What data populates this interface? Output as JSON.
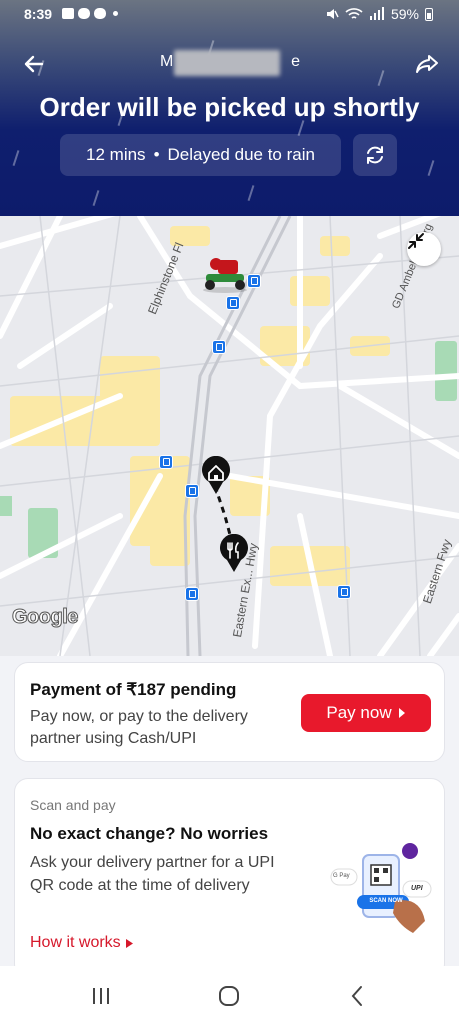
{
  "status_bar": {
    "time": "8:39",
    "battery": "59%"
  },
  "header": {
    "title_start": "M",
    "title_end": "e",
    "headline": "Order will be picked up shortly",
    "eta": "12 mins",
    "separator": "•",
    "delay_reason": "Delayed due to rain"
  },
  "map": {
    "attribution": "Google",
    "streets": [
      "Elphinstone Fl",
      "GD Ambek... Marg",
      "Eastern Ex... Hwy",
      "Eastern Fwy"
    ]
  },
  "payment_card": {
    "title": "Payment of ₹187 pending",
    "subtitle": "Pay now, or pay to the delivery partner using Cash/UPI",
    "button_label": "Pay now"
  },
  "scan_card": {
    "eyebrow": "Scan and pay",
    "title": "No exact change? No worries",
    "body": "Ask your delivery partner for a UPI QR code at the time of delivery",
    "link_label": "How it works",
    "illustration_button": "SCAN NOW",
    "illustration_gpay": "G Pay",
    "illustration_upi": "UPI"
  },
  "colors": {
    "header_bg": "#0d1b6b",
    "accent_red": "#e8192c",
    "link_red": "#d6182b"
  },
  "icons": {
    "back": "arrow-left-icon",
    "share": "share-icon",
    "refresh": "refresh-icon",
    "collapse": "collapse-icon",
    "home": "home-icon",
    "restaurant": "fork-knife-icon"
  }
}
